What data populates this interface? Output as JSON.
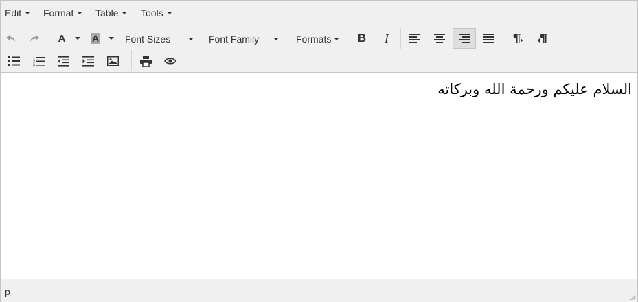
{
  "menubar": {
    "items": [
      {
        "label": "Edit"
      },
      {
        "label": "Format"
      },
      {
        "label": "Table"
      },
      {
        "label": "Tools"
      }
    ]
  },
  "toolbar": {
    "font_sizes_label": "Font Sizes",
    "font_family_label": "Font Family",
    "formats_label": "Formats",
    "text_color_glyph": "A",
    "bg_color_glyph": "A",
    "bold_glyph": "B",
    "italic_glyph": "I"
  },
  "content": {
    "paragraph": "السلام عليكم ورحمة الله وبركاته"
  },
  "statusbar": {
    "path": "p"
  },
  "colors": {
    "toolbar_bg": "#f0f0f0",
    "active_button_bg": "#dedede",
    "border": "#c5c5c5"
  }
}
